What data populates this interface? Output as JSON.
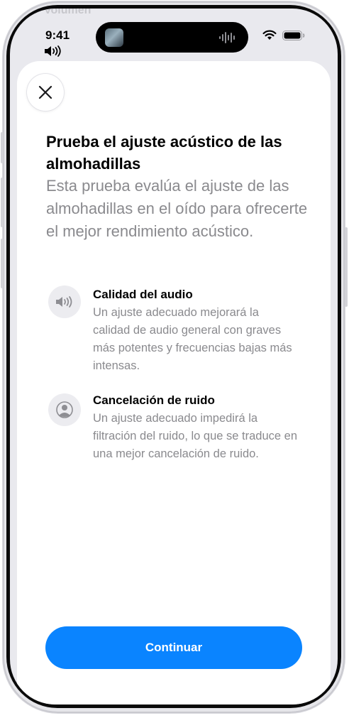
{
  "background": {
    "label": "Volumen"
  },
  "status_bar": {
    "time": "9:41",
    "volume_icon": "speaker-icon",
    "wifi_icon": "wifi-icon",
    "battery_icon": "battery-icon",
    "island_art_icon": "album-art-icon",
    "island_wave_icon": "waveform-icon"
  },
  "sheet": {
    "close_icon": "close-icon",
    "title": "Prueba el ajuste acústico de las almohadillas",
    "subtitle": "Esta prueba evalúa el ajuste de las almohadillas en el oído para ofrecerte el mejor rendimiento acústico.",
    "features": [
      {
        "icon": "speaker-icon",
        "title": "Calidad del audio",
        "description": "Un ajuste adecuado mejorará la calidad de audio general con graves más potentes y frecuencias bajas más intensas."
      },
      {
        "icon": "person-noise-icon",
        "title": "Cancelación de ruido",
        "description": "Un ajuste adecuado impedirá la filtración del ruido, lo que se traduce en una mejor cancelación de ruido."
      }
    ],
    "continue_label": "Continuar"
  },
  "colors": {
    "accent": "#0A84FF",
    "secondary_text": "#8A8A8E",
    "icon_background": "#ECECF0"
  }
}
